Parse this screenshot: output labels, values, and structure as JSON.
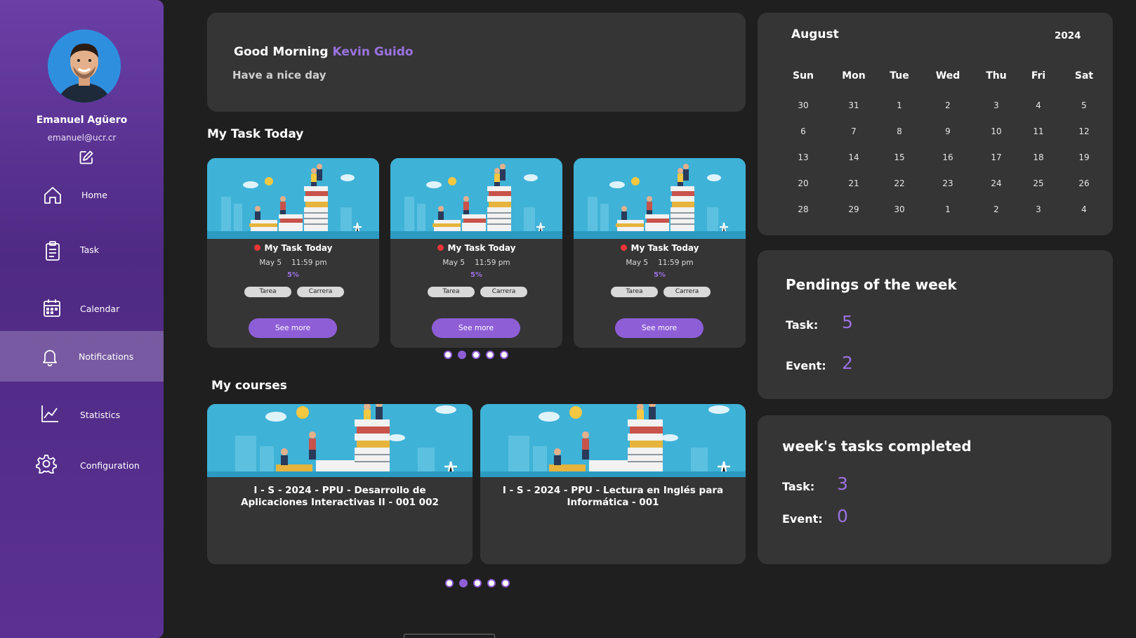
{
  "user": {
    "name": "Emanuel Agüero",
    "email": "emanuel@ucr.cr"
  },
  "nav": [
    {
      "label": "Home",
      "icon": "home-icon"
    },
    {
      "label": "Task",
      "icon": "clipboard-icon"
    },
    {
      "label": "Calendar",
      "icon": "calendar-icon"
    },
    {
      "label": "Notifications",
      "icon": "bell-icon",
      "active": true
    },
    {
      "label": "Statistics",
      "icon": "chart-icon"
    },
    {
      "label": "Configuration",
      "icon": "gear-icon"
    }
  ],
  "greeting": {
    "prefix": "Good Morning",
    "name": "Kevin Guido",
    "subtitle": "Have a nice day"
  },
  "tasks_section": {
    "title": "My Task Today"
  },
  "tasks": [
    {
      "title": "My Task Today",
      "date": "May 5",
      "time": "11:59 pm",
      "progress": "5%",
      "tags": [
        "Tarea",
        "Carrera"
      ],
      "button": "See more"
    },
    {
      "title": "My Task Today",
      "date": "May 5",
      "time": "11:59 pm",
      "progress": "5%",
      "tags": [
        "Tarea",
        "Carrera"
      ],
      "button": "See more"
    },
    {
      "title": "My Task Today",
      "date": "May 5",
      "time": "11:59 pm",
      "progress": "5%",
      "tags": [
        "Tarea",
        "Carrera"
      ],
      "button": "See more"
    }
  ],
  "courses_section": {
    "title": "My courses"
  },
  "courses": [
    {
      "title": "I - S - 2024 - PPU - Desarrollo de Aplicaciones Interactivas II - 001 002"
    },
    {
      "title": "I - S - 2024 - PPU - Lectura en Inglés para Informática - 001"
    }
  ],
  "carousel": {
    "pages": 5,
    "active_index": 1
  },
  "calendar": {
    "month": "August",
    "year": "2024",
    "weekdays": [
      "Sun",
      "Mon",
      "Tue",
      "Wed",
      "Thu",
      "Fri",
      "Sat"
    ],
    "weeks": [
      [
        "30",
        "31",
        "1",
        "2",
        "3",
        "4",
        "5"
      ],
      [
        "6",
        "7",
        "8",
        "9",
        "10",
        "11",
        "12"
      ],
      [
        "13",
        "14",
        "15",
        "16",
        "17",
        "18",
        "19"
      ],
      [
        "20",
        "21",
        "22",
        "23",
        "24",
        "25",
        "26"
      ],
      [
        "28",
        "29",
        "30",
        "1",
        "2",
        "3",
        "4"
      ]
    ]
  },
  "pendings": {
    "title": "Pendings of the week",
    "task_label": "Task:",
    "task_value": "5",
    "event_label": "Event:",
    "event_value": "2"
  },
  "completed": {
    "title": "week's tasks completed",
    "task_label": "Task:",
    "task_value": "3",
    "event_label": "Event:",
    "event_value": "0"
  },
  "colors": {
    "accent": "#8e5ed6",
    "sidebar": "#5a3192",
    "card": "#353535",
    "background": "#1f1f1f",
    "image_sky": "#3fb2d7"
  }
}
